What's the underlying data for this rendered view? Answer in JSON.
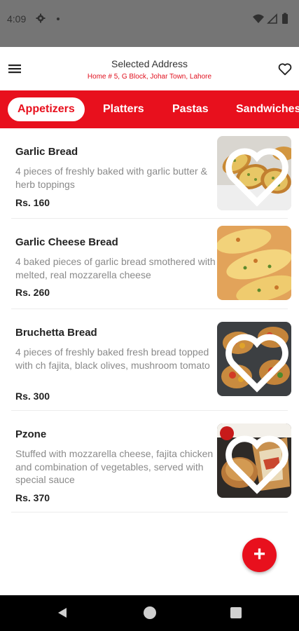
{
  "status_bar": {
    "time": "4:09"
  },
  "header": {
    "title": "Selected Address",
    "address": "Home # 5, G Block, Johar Town, Lahore"
  },
  "tabs": [
    {
      "label": "Appetizers",
      "active": true
    },
    {
      "label": "Platters",
      "active": false
    },
    {
      "label": "Pastas",
      "active": false
    },
    {
      "label": "Sandwiches",
      "active": false
    }
  ],
  "menu_items": [
    {
      "name": "Garlic Bread",
      "description": "4 pieces of freshly baked with garlic butter & herb toppings",
      "price": "Rs. 160"
    },
    {
      "name": "Garlic Cheese Bread",
      "description": "4 baked pieces of garlic bread smothered with melted, real mozzarella cheese",
      "price": "Rs. 260"
    },
    {
      "name": "Bruchetta Bread",
      "description": "4 pieces of freshly baked fresh bread topped with ch fajita, black olives, mushroom tomato",
      "price": "Rs. 300"
    },
    {
      "name": "Pzone",
      "description": "Stuffed with mozzarella cheese, fajita chicken and combination of vegetables, served with special sauce",
      "price": "Rs. 370"
    }
  ],
  "fab": {
    "label": "+"
  },
  "colors": {
    "accent": "#e8101d",
    "text": "#222222",
    "muted": "#8a8a8a"
  }
}
